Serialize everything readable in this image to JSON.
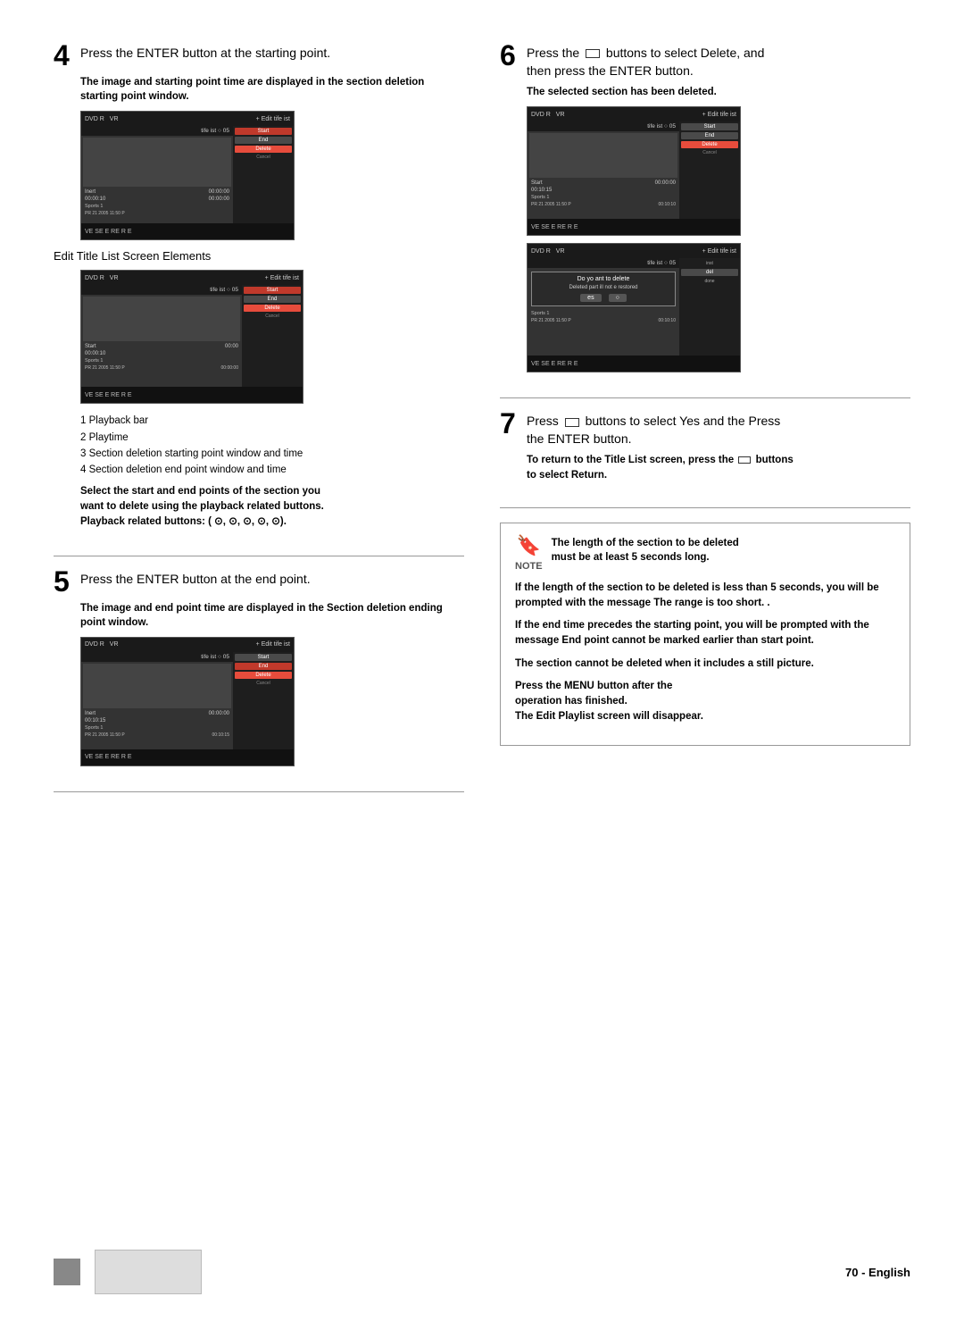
{
  "page": {
    "footer_page_number": "70 - English"
  },
  "steps": {
    "step4": {
      "number": "4",
      "title": "Press the ENTER button at the starting point.",
      "subtitle": "The image and starting point time are displayed in the section deletion starting point window.",
      "elements_title": "Edit Title List Screen Elements",
      "elements": [
        "1 Playback bar",
        "2 Playtime",
        "3 Section deletion starting point window and time",
        "4 Section deletion end point window and time"
      ],
      "elements_note_line1": "Select the start and end points of the section you",
      "elements_note_line2": "want to delete using the playback related buttons.",
      "elements_note_line3": "Playback related buttons: ( ⊙, ⊙, ⊙, ⊙, ⊙)."
    },
    "step5": {
      "number": "5",
      "title": "Press the ENTER button at the end point.",
      "subtitle": "The image and end point time are displayed in the Section deletion ending point window."
    },
    "step6": {
      "number": "6",
      "title_prefix": "Press the",
      "title_middle": "buttons to select Delete, and",
      "title_line2": "then press the ENTER button.",
      "subtitle": "The selected section has been deleted."
    },
    "step7": {
      "number": "7",
      "title_prefix": "Press",
      "title_middle": "buttons to select Yes and the Press",
      "title_line2": "the ENTER button.",
      "return_note_bold": "To return to the Title List screen, press the",
      "return_note_middle": "buttons",
      "return_note_end": "to select Return."
    }
  },
  "note": {
    "icon": "🔖",
    "word": "NOTE",
    "para1_line1": "The length of the section to be deleted",
    "para1_line2": "must be at least 5 seconds long.",
    "para2": "If the length of the section to be deleted is less than 5 seconds, you will be prompted with the message  The range is too short. .",
    "para3": "If the end time precedes the starting point, you will be prompted with the message End point cannot be marked earlier than start point.",
    "para4": "The section cannot be deleted when it includes a still picture.",
    "para5_line1": "Press the MENU button after the",
    "para5_line2": "operation has finished.",
    "para5_line3": "The Edit Playlist screen will disappear."
  },
  "dvd_ui": {
    "top_label": "DVD R",
    "vr_label": "VR",
    "menu_items": "+ Edit  tife  ist",
    "tife_label": "tife  ist  ○  05",
    "start_btn": "Start",
    "end_btn": "End",
    "insert_label": "Inert",
    "delete_btn": "Delete",
    "time1": "00:00:10",
    "time2": "00:00:00",
    "time3": "00:10:15",
    "time4": "00:10:10",
    "sports_label": "Sports  1",
    "pr_label": "PR 21  2005 11:50 P",
    "bottom_icons": "VE   SE E   RE R   E",
    "confirm_title": "Do yo  ant to delete",
    "confirm_sub": "Deleted part  ill not  e restored",
    "confirm_yes": "es",
    "confirm_no": "○"
  }
}
